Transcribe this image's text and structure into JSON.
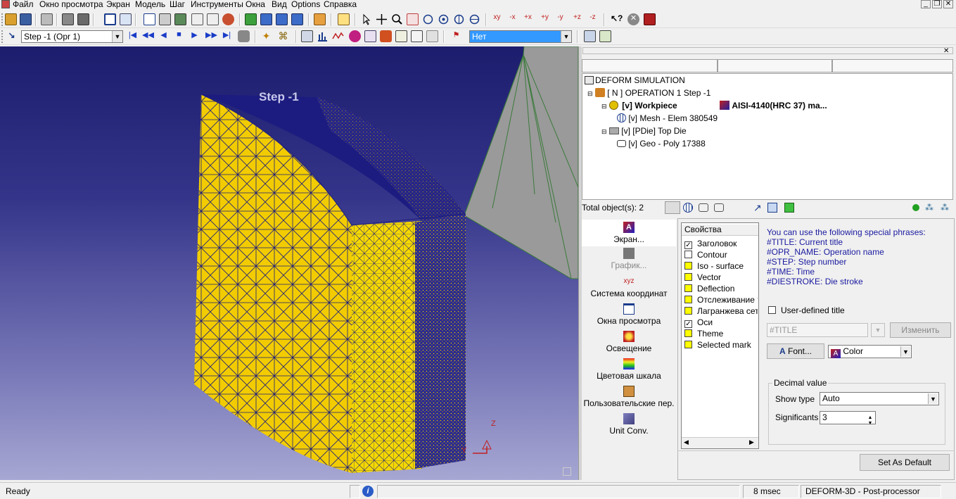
{
  "menu": {
    "items": [
      "Файл",
      "Окно просмотра",
      "Экран",
      "Модель",
      "Шаг",
      "Инструменты",
      "Окна",
      "Вид",
      "Options",
      "Справка"
    ]
  },
  "toolbar2": {
    "step_select": "Step  -1 (Opr 1)",
    "state_select": "Нет"
  },
  "viewport": {
    "title": "Step    -1",
    "axis_z": "Z",
    "axis_y": "Y"
  },
  "tree": {
    "root": "DEFORM SIMULATION",
    "operation": "[ N ]  OPERATION 1  Step -1",
    "workpiece": "[v] Workpiece",
    "material": "AISI-4140(HRC 37) ma...",
    "mesh": "[v] Mesh - Elem 380549",
    "die": "[v] [PDie] Top Die",
    "geo": "[v] Geo - Poly 17388"
  },
  "objbar": {
    "total": "Total object(s): 2"
  },
  "leftnav": [
    {
      "label": "Экран...",
      "icon": "screen-icon"
    },
    {
      "label": "График...",
      "icon": "graph-icon"
    },
    {
      "label": "Система координат",
      "icon": "coordinate-system-icon"
    },
    {
      "label": "Окна просмотра",
      "icon": "viewport-icon"
    },
    {
      "label": "Освещение",
      "icon": "lighting-icon"
    },
    {
      "label": "Цветовая шкала",
      "icon": "color-scale-icon"
    },
    {
      "label": "Пользовательские пер.",
      "icon": "user-variables-icon"
    },
    {
      "label": "Unit Conv.",
      "icon": "unit-conversion-icon"
    }
  ],
  "props": {
    "header": "Свойства",
    "items": [
      {
        "label": "Заголовок",
        "checked": true
      },
      {
        "label": "Contour",
        "checked": false
      },
      {
        "label": "Iso - surface",
        "checked": false
      },
      {
        "label": "Vector",
        "checked": false
      },
      {
        "label": "Deflection",
        "checked": false
      },
      {
        "label": "Отслеживание то",
        "checked": false
      },
      {
        "label": "Лагранжева сетк",
        "checked": false
      },
      {
        "label": "Оси",
        "checked": true
      },
      {
        "label": "Theme",
        "checked": false
      },
      {
        "label": "Selected mark",
        "checked": false
      }
    ]
  },
  "settings": {
    "help": [
      "You can use the following special phrases:",
      "#TITLE: Current title",
      "#OPR_NAME: Operation name",
      "#STEP: Step number",
      "#TIME: Time",
      "#DIESTROKE: Die stroke"
    ],
    "user_title_label": "User-defined title",
    "title_value": "#TITLE",
    "change_button": "Изменить",
    "font_button": "Font...",
    "color_select": "Color",
    "decimal_group": "Decimal value",
    "show_type_label": "Show type",
    "show_type_value": "Auto",
    "significants_label": "Significants",
    "significants_value": "3",
    "default_button": "Set As Default"
  },
  "status": {
    "ready": "Ready",
    "time": "8 msec",
    "app": "DEFORM-3D  -  Post-processor"
  },
  "colors": {
    "workpiece": "#f2cc00",
    "mesh_line": "#1c1c80",
    "background_top": "#1d1d6e",
    "die": "#9a9a9a",
    "highlight": "#3399ff"
  }
}
